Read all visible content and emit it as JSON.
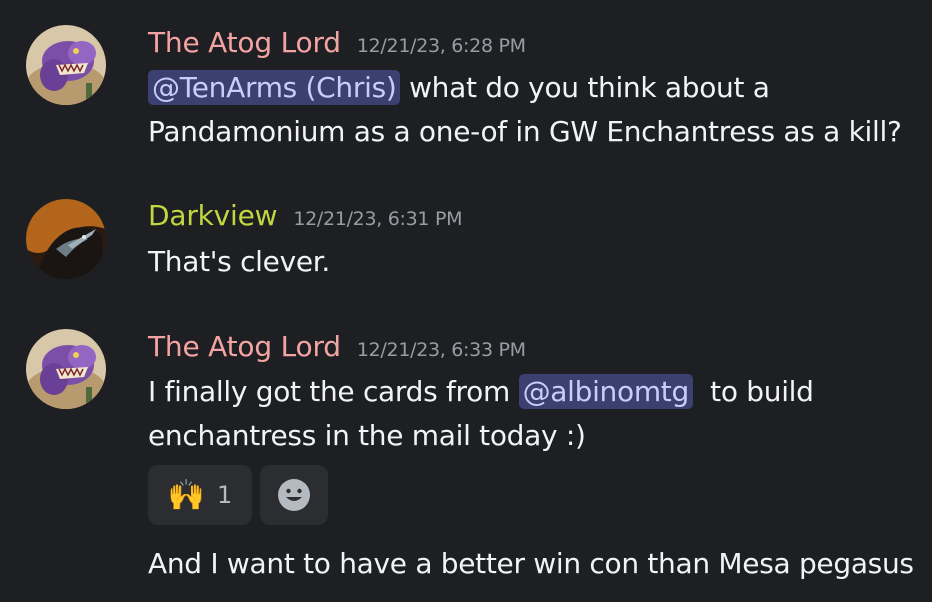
{
  "messages": [
    {
      "author": "The Atog Lord",
      "author_color": "#f4a3a3",
      "timestamp": "12/21/23, 6:28 PM",
      "avatar": "purple-monster-avatar",
      "lines": [
        {
          "mention": "@TenArms (Chris)",
          "after": " what do you think about a"
        },
        {
          "text": "Pandamonium as a one-of in GW Enchantress as a kill?"
        }
      ]
    },
    {
      "author": "Darkview",
      "author_color": "#c2d63f",
      "timestamp": "12/21/23, 6:31 PM",
      "avatar": "dark-dragon-avatar",
      "lines": [
        {
          "text": "That's clever."
        }
      ]
    },
    {
      "author": "The Atog Lord",
      "author_color": "#f4a3a3",
      "timestamp": "12/21/23, 6:33 PM",
      "avatar": "purple-monster-avatar",
      "lines": [
        {
          "before": "I finally got the cards from ",
          "mention": "@albinomtg",
          "after": "  to build"
        },
        {
          "text": "enchantress in the mail today :)"
        }
      ],
      "reactions": [
        {
          "emoji": "🙌",
          "count": "1",
          "icon": "raising-hands-emoji"
        },
        {
          "icon": "add-reaction-smiley-icon"
        }
      ]
    },
    {
      "lines": [
        {
          "text": "And I want to have a better win con than Mesa pegasus"
        }
      ]
    }
  ],
  "colors": {
    "background": "#1e1f22",
    "mention_bg": "#3b4070",
    "mention_text": "#c9cdfb",
    "timestamp": "#9a9ca3"
  }
}
